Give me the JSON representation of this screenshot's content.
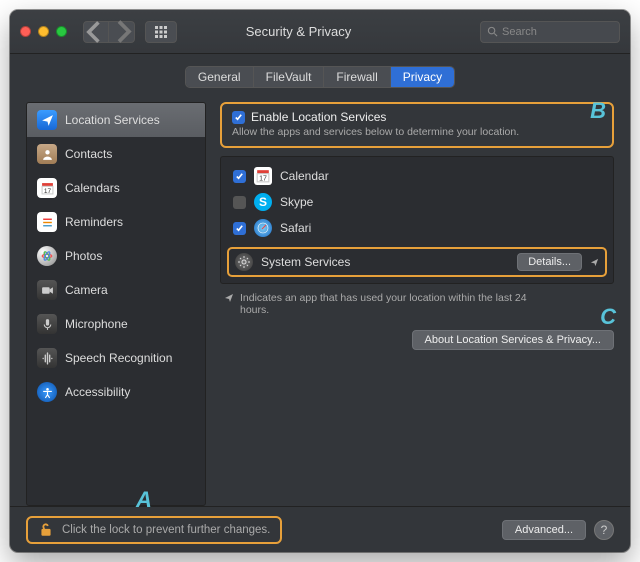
{
  "window": {
    "title": "Security & Privacy",
    "search_placeholder": "Search"
  },
  "tabs": [
    {
      "label": "General"
    },
    {
      "label": "FileVault"
    },
    {
      "label": "Firewall"
    },
    {
      "label": "Privacy",
      "active": true
    }
  ],
  "sidebar": {
    "items": [
      {
        "label": "Location Services",
        "icon": "location-arrow-icon",
        "selected": true
      },
      {
        "label": "Contacts",
        "icon": "contacts-icon"
      },
      {
        "label": "Calendars",
        "icon": "calendar-icon"
      },
      {
        "label": "Reminders",
        "icon": "reminders-icon"
      },
      {
        "label": "Photos",
        "icon": "photos-icon"
      },
      {
        "label": "Camera",
        "icon": "camera-icon"
      },
      {
        "label": "Microphone",
        "icon": "microphone-icon"
      },
      {
        "label": "Speech Recognition",
        "icon": "speech-icon"
      },
      {
        "label": "Accessibility",
        "icon": "accessibility-icon"
      }
    ]
  },
  "enable": {
    "checkbox_label": "Enable Location Services",
    "subtitle": "Allow the apps and services below to determine your location."
  },
  "apps": [
    {
      "name": "Calendar",
      "checked": true,
      "icon": "calendar-app-icon"
    },
    {
      "name": "Skype",
      "checked": false,
      "icon": "skype-icon"
    },
    {
      "name": "Safari",
      "checked": true,
      "icon": "safari-icon"
    }
  ],
  "system_services": {
    "label": "System Services",
    "button": "Details..."
  },
  "indicator_text": "Indicates an app that has used your location within the last 24 hours.",
  "about_button": "About Location Services & Privacy...",
  "lock_text": "Click the lock to prevent further changes.",
  "advanced_button": "Advanced...",
  "annotations": {
    "a": "A",
    "b": "B",
    "c": "C"
  }
}
